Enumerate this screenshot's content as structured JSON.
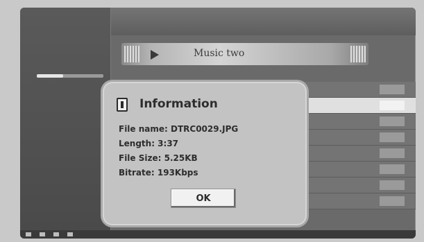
{
  "dialog": {
    "title": "Information",
    "file_name": "File name: DTRC0029.JPG",
    "length": "Length: 3:37",
    "file_size": "File Size: 5.25KB",
    "bitrate": "Bitrate: 193Kbps",
    "ok_label": "OK"
  },
  "background": {
    "banner_title": "Music two",
    "icons": [
      "play-icon",
      "information-icon"
    ]
  }
}
